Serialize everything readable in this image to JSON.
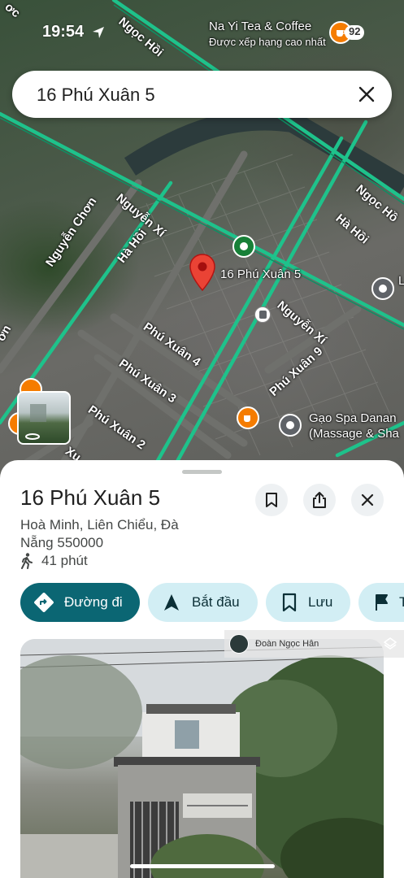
{
  "status_bar": {
    "time": "19:54"
  },
  "search": {
    "query": "16 Phú Xuân 5"
  },
  "map": {
    "streets": {
      "ngoc_hoi_top": "Ngọc Hồi",
      "ngoc_hoi_right": "Ngọc Hồ",
      "ha_hoi_right": "Hà Hồi",
      "nguyen_chon": "Nguyễn Chơn",
      "nguyen_xi_left": "Nguyễn Xí",
      "ha_hoi_left": "Hà Hồi",
      "nguyen_xi_right": "Nguyễn Xí",
      "phu_xuan_4": "Phú Xuân 4",
      "phu_xuan_3": "Phú Xuân 3",
      "phu_xuan_2": "Phú Xuân 2",
      "phu_xuan_9": "Phú Xuân 9",
      "left_edge": "ơn",
      "top_left_edge": "ơc",
      "bottom_left_edge": "Xu"
    },
    "pin_label": "16 Phú Xuân 5",
    "cafe": {
      "name": "Na Yi Tea & Coffee",
      "subtitle": "Được xếp hạng cao nhất",
      "badge": "92"
    },
    "spa": {
      "line1": "Gạo Spa Danan",
      "line2": "(Massage & Sha"
    },
    "right_edge_letter": "L",
    "colors": {
      "route": "#1ec28b",
      "pin": "#ea4335",
      "cafe": "#f57c00",
      "poi_green": "#188038",
      "poi_gray": "#5f6368"
    }
  },
  "place": {
    "title": "16 Phú Xuân 5",
    "address": "Hoà Minh, Liên Chiểu, Đà Nẵng 550000",
    "walk_time": "41 phút"
  },
  "actions": {
    "directions": "Đường đi",
    "start": "Bắt đầu",
    "save": "Lưu",
    "more_letter": "T"
  },
  "photo": {
    "credit": "Đoàn Ngọc Hân"
  },
  "icons": {
    "save": "bookmark-icon",
    "share": "share-icon",
    "close": "close-icon",
    "walk": "walking-icon",
    "directions": "directions-icon",
    "navigate": "navigation-arrow-icon",
    "flag": "flag-icon"
  }
}
